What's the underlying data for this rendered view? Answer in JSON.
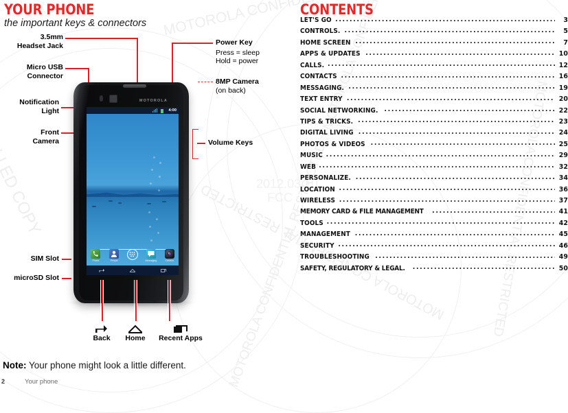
{
  "page": {
    "title": "YOUR PHONE",
    "subtitle": "the important keys & connectors",
    "note_label": "Note:",
    "note_text": " Your phone might look a little different.",
    "folio_number": "2",
    "folio_label": "Your phone",
    "accent_red": "#d6232a",
    "title_red": "#e02b2b"
  },
  "watermark": {
    "date": "2012.03.10",
    "agency": "FCC",
    "lines": [
      "MOTOROLA CONFIDENTIAL RESTRICTED :: MOTOROLA CONFIDENTIAL RESTRICTED",
      "CONTROLLED COPY",
      "MOTOROLA CONFIDENTIAL RESTRICTED"
    ]
  },
  "callouts": {
    "headset_jack": "3.5mm\nHeadset Jack",
    "headset_jack_l1": "3.5mm",
    "headset_jack_l2": "Headset Jack",
    "micro_usb_l1": "Micro USB",
    "micro_usb_l2": "Connector",
    "notification_light_l1": "Notification",
    "notification_light_l2": "Light",
    "front_camera_l1": "Front",
    "front_camera_l2": "Camera",
    "sim_slot": "SIM Slot",
    "microsd_slot": "microSD Slot",
    "power_key": "Power Key",
    "power_key_sub1": "Press = sleep",
    "power_key_sub2": "Hold = power",
    "camera_8mp": "8MP Camera",
    "camera_8mp_sub": "(on back)",
    "volume_keys": "Volume Keys"
  },
  "nav_legend": [
    {
      "label": "Back",
      "icon": "back-arrow-icon"
    },
    {
      "label": "Home",
      "icon": "home-icon"
    },
    {
      "label": "Recent Apps",
      "icon": "recent-apps-icon"
    }
  ],
  "phone": {
    "brand": "MOTOROLA",
    "status_clock": "4:00",
    "dock": [
      {
        "label": "Phone",
        "icon": "phone-icon",
        "color": "#4f9e36"
      },
      {
        "label": "People",
        "icon": "people-icon",
        "color": "#3c5fb0"
      },
      {
        "label": "",
        "icon": "app-drawer-icon",
        "color": "#ffffff"
      },
      {
        "label": "Messaging",
        "icon": "messaging-icon",
        "color": "#2aa7c4"
      },
      {
        "label": "Camera",
        "icon": "camera-icon",
        "color": "#1c1c22"
      }
    ],
    "navbar": [
      {
        "icon": "back-arrow-icon"
      },
      {
        "icon": "home-icon"
      },
      {
        "icon": "recent-apps-icon"
      }
    ]
  },
  "contents": {
    "title": "CONTENTS",
    "items": [
      {
        "label": "LET'S GO",
        "page": "3"
      },
      {
        "label": "CONTROLS.",
        "page": "5"
      },
      {
        "label": "HOME SCREEN",
        "page": "7"
      },
      {
        "label": "APPS & UPDATES",
        "page": "10"
      },
      {
        "label": "CALLS.",
        "page": "12"
      },
      {
        "label": "CONTACTS",
        "page": "16"
      },
      {
        "label": "MESSAGING.",
        "page": "19"
      },
      {
        "label": "TEXT ENTRY",
        "page": "20"
      },
      {
        "label": "SOCIAL NETWORKING.",
        "page": "22"
      },
      {
        "label": "TIPS & TRICKS.",
        "page": "23"
      },
      {
        "label": "DIGITAL LIVING",
        "page": "24"
      },
      {
        "label": "PHOTOS & VIDEOS",
        "page": "25"
      },
      {
        "label": "MUSIC",
        "page": "29"
      },
      {
        "label": "WEB",
        "page": "32"
      },
      {
        "label": "PERSONALIZE.",
        "page": "34"
      },
      {
        "label": "LOCATION",
        "page": "36"
      },
      {
        "label": "WIRELESS",
        "page": "37"
      },
      {
        "label": "MEMORY CARD & FILE MANAGEMENT",
        "page": "41"
      },
      {
        "label": "TOOLS",
        "page": "42"
      },
      {
        "label": "MANAGEMENT",
        "page": "45"
      },
      {
        "label": "SECURITY",
        "page": "46"
      },
      {
        "label": "TROUBLESHOOTING",
        "page": "49"
      },
      {
        "label": "SAFETY, REGULATORY & LEGAL.",
        "page": "50"
      }
    ]
  }
}
